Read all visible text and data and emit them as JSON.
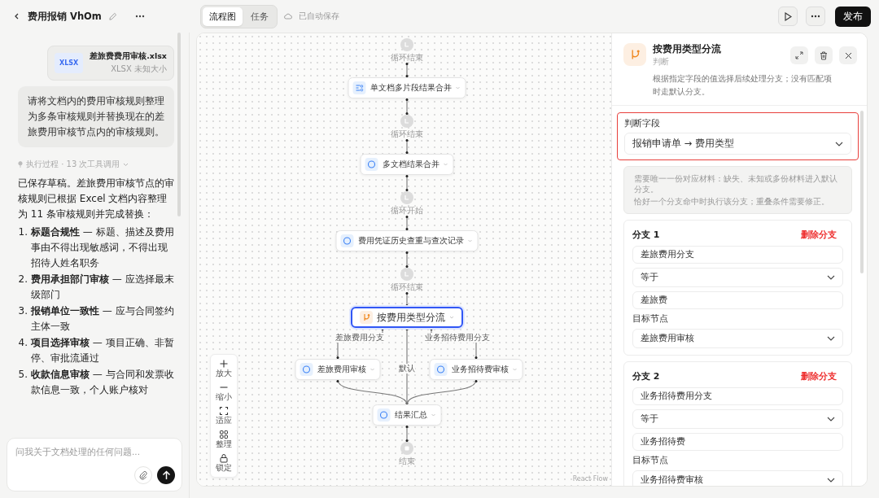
{
  "header": {
    "title": "费用报销 VhOm",
    "tabs": [
      {
        "label": "流程图",
        "selected": true
      },
      {
        "label": "任务",
        "selected": false
      }
    ],
    "save_status": "已自动保存",
    "publish": "发布"
  },
  "chat": {
    "attachment": {
      "badge": "XLSX",
      "name": "差旅费费用审核.xlsx",
      "meta": "XLSX 未知大小"
    },
    "user_message": "请将文档内的费用审核规则整理为多条审核规则并替换现在的差旅费用审核节点内的审核规则。",
    "process": "执行过程 · 13 次工具调用",
    "reply_intro": "已保存草稿。差旅费用审核节点的审核规则已根据 Excel 文档内容整理为 11 条审核规则并完成替换：",
    "reply_items": [
      {
        "number": "1.",
        "text": "**标题合规性** — 标题、描述及费用事由不得出现敏感词，不得出现招待人姓名职务"
      },
      {
        "number": "2.",
        "text": "**费用承担部门审核** — 应选择最末级部门"
      },
      {
        "number": "3.",
        "text": "**报销单位一致性** — 应与合同签约主体一致"
      },
      {
        "number": "4.",
        "text": "**项目选择审核** — 项目正确、非暂停、审批流通过"
      },
      {
        "number": "5.",
        "text": "**收款信息审核** — 与合同和发票收款信息一致，个人账户核对"
      }
    ],
    "input": {
      "placeholder": "问我关于文档处理的任何问题..."
    }
  },
  "flow": {
    "nodes": [
      {
        "kind": "marker",
        "label": "循环结束"
      },
      {
        "kind": "list-step",
        "label": "单文档多片段结果合并",
        "selected": false
      },
      {
        "kind": "marker",
        "label": "循环结束"
      },
      {
        "kind": "step",
        "label": "多文档结果合并",
        "selected": false
      },
      {
        "kind": "marker",
        "label": "循环开始"
      },
      {
        "kind": "step",
        "label": "费用凭证历史查重与查次记录",
        "selected": false
      },
      {
        "kind": "marker",
        "label": "循环结束"
      },
      {
        "kind": "branch-step",
        "label": "按费用类型分流",
        "selected": true
      },
      {
        "kind": "step",
        "label": "差旅费用审核",
        "selected": false
      },
      {
        "kind": "step",
        "label": "业务招待费审核",
        "selected": false
      },
      {
        "kind": "step",
        "label": "结果汇总",
        "selected": false
      },
      {
        "kind": "end",
        "label": "结束"
      }
    ],
    "edge_labels": [
      "差旅费用分支",
      "默认",
      "业务招待费用分支"
    ],
    "controls": [
      {
        "kind": "zoom-in",
        "label": "放大"
      },
      {
        "kind": "zoom-out",
        "label": "缩小"
      },
      {
        "kind": "fit",
        "label": "适应"
      },
      {
        "kind": "arrange",
        "label": "整理"
      },
      {
        "kind": "lock",
        "label": "锁定"
      }
    ],
    "attribution": "React Flow"
  },
  "inspector": {
    "title": "按费用类型分流",
    "type": "判断",
    "description": "根据指定字段的值选择后续处理分支；没有匹配项时走默认分支。",
    "field": {
      "label": "判断字段",
      "value": "报销申请单 → 费用类型",
      "highlighted": true
    },
    "note": [
      "需要唯一一份对应材料：缺失、未知或多份材料进入默认分支。",
      "恰好一个分支命中时执行该分支；重叠条件需要修正。"
    ],
    "branches": [
      {
        "title": "分支 1",
        "delete": "删除分支",
        "name": "差旅费用分支",
        "operator": "等于",
        "value": "差旅费",
        "target_label": "目标节点",
        "target": "差旅费用审核"
      },
      {
        "title": "分支 2",
        "delete": "删除分支",
        "name": "业务招待费用分支",
        "operator": "等于",
        "value": "业务招待费",
        "target_label": "目标节点",
        "target": "业务招待费审核"
      }
    ]
  }
}
